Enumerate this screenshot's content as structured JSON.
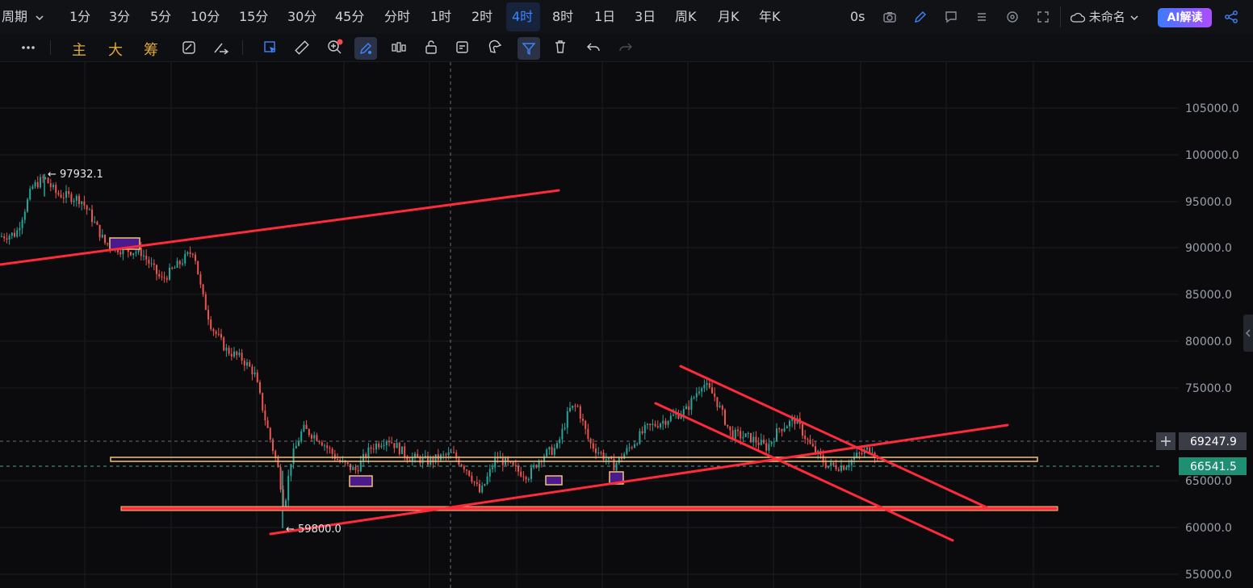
{
  "topbar": {
    "period_label": "周期",
    "intervals": [
      "1分",
      "3分",
      "5分",
      "10分",
      "15分",
      "30分",
      "45分",
      "分时",
      "1时",
      "2时",
      "4时",
      "8时",
      "1日",
      "3日",
      "周K",
      "月K",
      "年K"
    ],
    "active_interval": "4时",
    "countdown": "0s",
    "layout_name": "未命名",
    "ai_button": "AI解读"
  },
  "toolbar": {
    "indicator_main": "主",
    "indicator_big": "大",
    "indicator_chip": "筹"
  },
  "chart": {
    "price_labels": [
      "105000.0",
      "100000.0",
      "95000.0",
      "90000.0",
      "85000.0",
      "80000.0",
      "75000.0",
      "65000.0",
      "60000.0",
      "55000.0"
    ],
    "high_marker": "← 97932.1",
    "low_marker": "← 59800.0",
    "crosshair_price": "69247.9",
    "last_price": "66541.5",
    "colors": {
      "up": "#26a69a",
      "down": "#ef5350",
      "trendline": "#ff2a3a",
      "zone_border": "#f2c27a",
      "zone_fill": "#4b1a8c",
      "last_price_bg": "#1f8f74",
      "crosshair_bg": "#3a3d45"
    }
  }
}
